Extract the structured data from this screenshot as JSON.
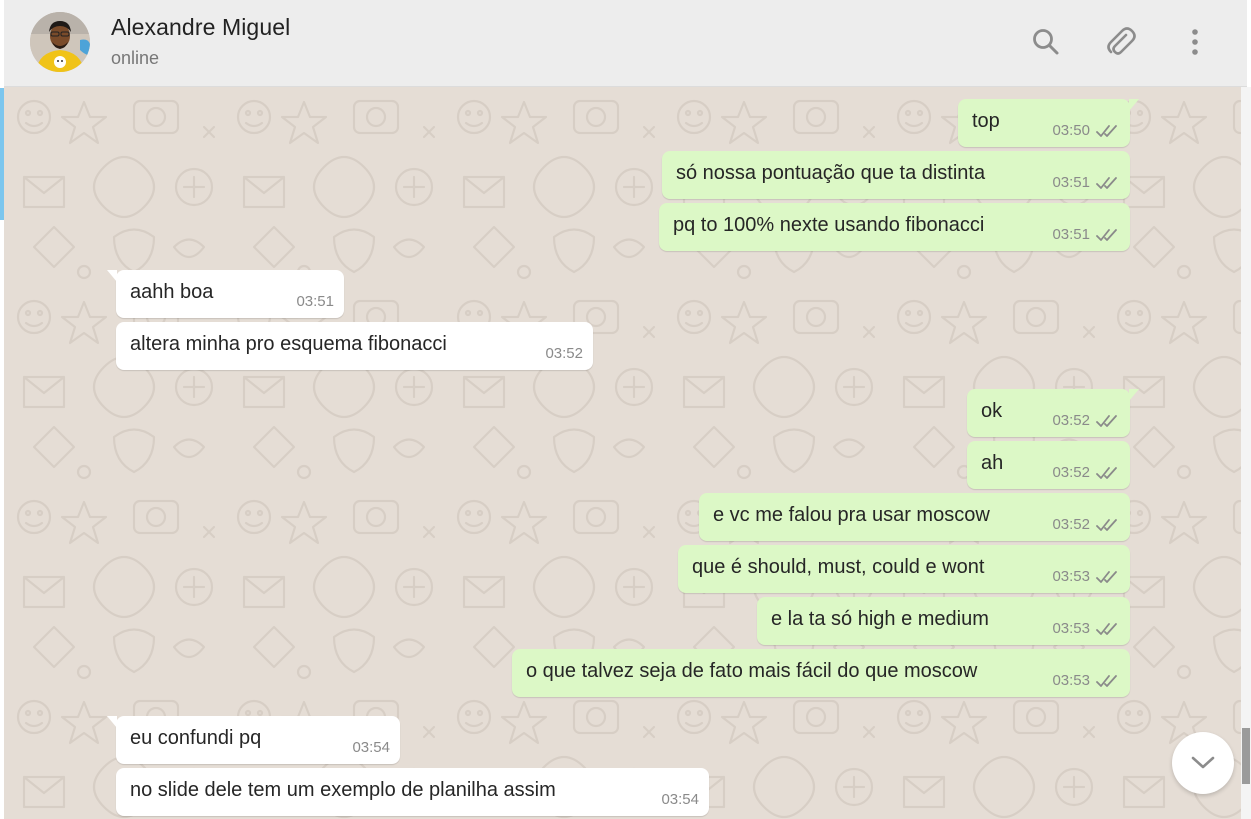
{
  "header": {
    "contact_name": "Alexandre Miguel",
    "status": "online",
    "icons": [
      "search-icon",
      "attach-icon",
      "menu-icon"
    ]
  },
  "colors": {
    "outgoing_bubble": "#dcf8c6",
    "incoming_bubble": "#ffffff",
    "chat_background": "#e5ddd5",
    "header_background": "#ededed",
    "read_ticks": "#8a8a8a"
  },
  "messages": [
    {
      "direction": "out",
      "text": "top",
      "time": "03:50",
      "status": "read"
    },
    {
      "direction": "out",
      "text": "só nossa pontuação que ta distinta",
      "time": "03:51",
      "status": "read"
    },
    {
      "direction": "out",
      "text": "pq to 100% nexte usando fibonacci",
      "time": "03:51",
      "status": "read"
    },
    {
      "direction": "in",
      "text": "aahh boa",
      "time": "03:51"
    },
    {
      "direction": "in",
      "text": "altera minha pro esquema fibonacci",
      "time": "03:52"
    },
    {
      "direction": "out",
      "text": "ok",
      "time": "03:52",
      "status": "read"
    },
    {
      "direction": "out",
      "text": "ah",
      "time": "03:52",
      "status": "read"
    },
    {
      "direction": "out",
      "text": "e vc me falou pra usar moscow",
      "time": "03:52",
      "status": "read"
    },
    {
      "direction": "out",
      "text": "que é should, must, could e wont",
      "time": "03:53",
      "status": "read"
    },
    {
      "direction": "out",
      "text": "e la ta só high e medium",
      "time": "03:53",
      "status": "read"
    },
    {
      "direction": "out",
      "text": "o que talvez seja de fato mais fácil do que moscow",
      "time": "03:53",
      "status": "read"
    },
    {
      "direction": "in",
      "text": "eu confundi pq",
      "time": "03:54"
    },
    {
      "direction": "in",
      "text": "no slide dele tem um exemplo de planilha assim",
      "time": "03:54"
    }
  ],
  "scroll_down_icon": "chevron-down-icon"
}
